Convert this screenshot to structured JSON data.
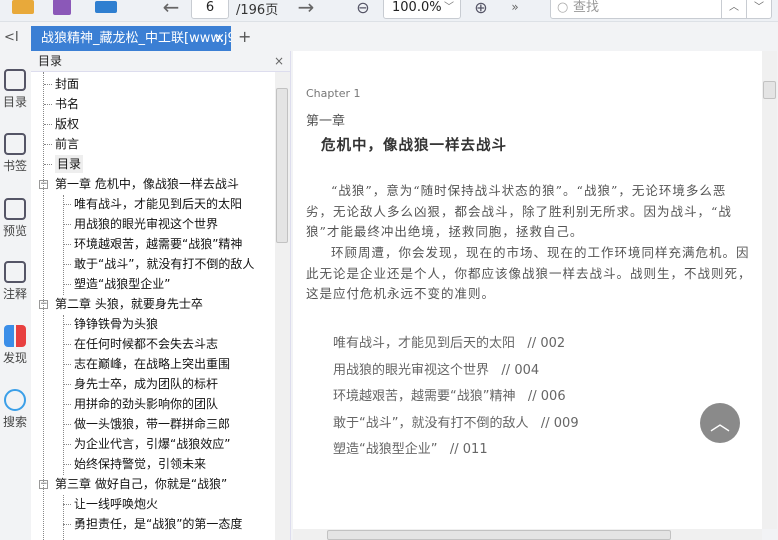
{
  "toolbar": {
    "page_current": "6",
    "page_total": "/196页",
    "zoom": "100.0%",
    "search_placeholder": "查找",
    "more": "»"
  },
  "tabs": [
    {
      "label": "战狼精神_藏龙松_中工联[www.j9"
    }
  ],
  "tab_add": "+",
  "collapse": "<I",
  "rail": [
    {
      "label": "目录"
    },
    {
      "label": "书签"
    },
    {
      "label": "预览"
    },
    {
      "label": "注释"
    },
    {
      "label": "发现"
    },
    {
      "label": "搜索"
    }
  ],
  "toc": {
    "title": "目录",
    "items": [
      {
        "label": "封面",
        "level": 1
      },
      {
        "label": "书名",
        "level": 1
      },
      {
        "label": "版权",
        "level": 1
      },
      {
        "label": "前言",
        "level": 1
      },
      {
        "label": "目录",
        "level": 1,
        "selected": true
      },
      {
        "label": "第一章 危机中，像战狼一样去战斗",
        "level": 1,
        "expanded": true
      },
      {
        "label": "唯有战斗，才能见到后天的太阳",
        "level": 2
      },
      {
        "label": "用战狼的眼光审视这个世界",
        "level": 2
      },
      {
        "label": "环境越艰苦，越需要“战狼”精神",
        "level": 2
      },
      {
        "label": "敢于“战斗”，就没有打不倒的敌人",
        "level": 2
      },
      {
        "label": "塑造“战狼型企业”",
        "level": 2
      },
      {
        "label": "第二章 头狼，就要身先士卒",
        "level": 1,
        "expanded": true
      },
      {
        "label": "铮铮铁骨为头狼",
        "level": 2
      },
      {
        "label": "在任何时候都不会失去斗志",
        "level": 2
      },
      {
        "label": "志在巅峰，在战略上突出重围",
        "level": 2
      },
      {
        "label": "身先士卒，成为团队的标杆",
        "level": 2
      },
      {
        "label": "用拼命的劲头影响你的团队",
        "level": 2
      },
      {
        "label": "做一头饿狼，带一群拼命三郎",
        "level": 2
      },
      {
        "label": "为企业代言，引爆“战狼效应”",
        "level": 2
      },
      {
        "label": "始终保持警觉，引领未来",
        "level": 2
      },
      {
        "label": "第三章 做好自己，你就是“战狼”",
        "level": 1,
        "expanded": true
      },
      {
        "label": "让一线呼唤炮火",
        "level": 2
      },
      {
        "label": "勇担责任，是“战狼”的第一态度",
        "level": 2
      }
    ]
  },
  "page": {
    "chapter_en": "Chapter 1",
    "chapter_cn": "第一章",
    "title": "危机中，像战狼一样去战斗",
    "paragraphs": [
      "“战狼”，意为“随时保持战斗状态的狼”。“战狼”，无论环境多么恶劣，无论敌人多么凶狠，都会战斗，除了胜利别无所求。因为战斗，“战狼”才能最终冲出绝境，拯救同胞，拯救自己。",
      "环顾周遭，你会发现，现在的市场、现在的工作环境同样充满危机。因此无论是企业还是个人，你都应该像战狼一样去战斗。战则生，不战则死，这是应付危机永远不变的准则。"
    ],
    "contents": [
      {
        "label": "唯有战斗，才能见到后天的太阳",
        "page": "// 002"
      },
      {
        "label": "用战狼的眼光审视这个世界",
        "page": "// 004"
      },
      {
        "label": "环境越艰苦，越需要“战狼”精神",
        "page": "// 006"
      },
      {
        "label": "敢于“战斗”，就没有打不倒的敌人",
        "page": "// 009"
      },
      {
        "label": "塑造“战狼型企业”",
        "page": "// 011"
      }
    ]
  },
  "colors": {
    "accent": "#3b7fd4"
  }
}
